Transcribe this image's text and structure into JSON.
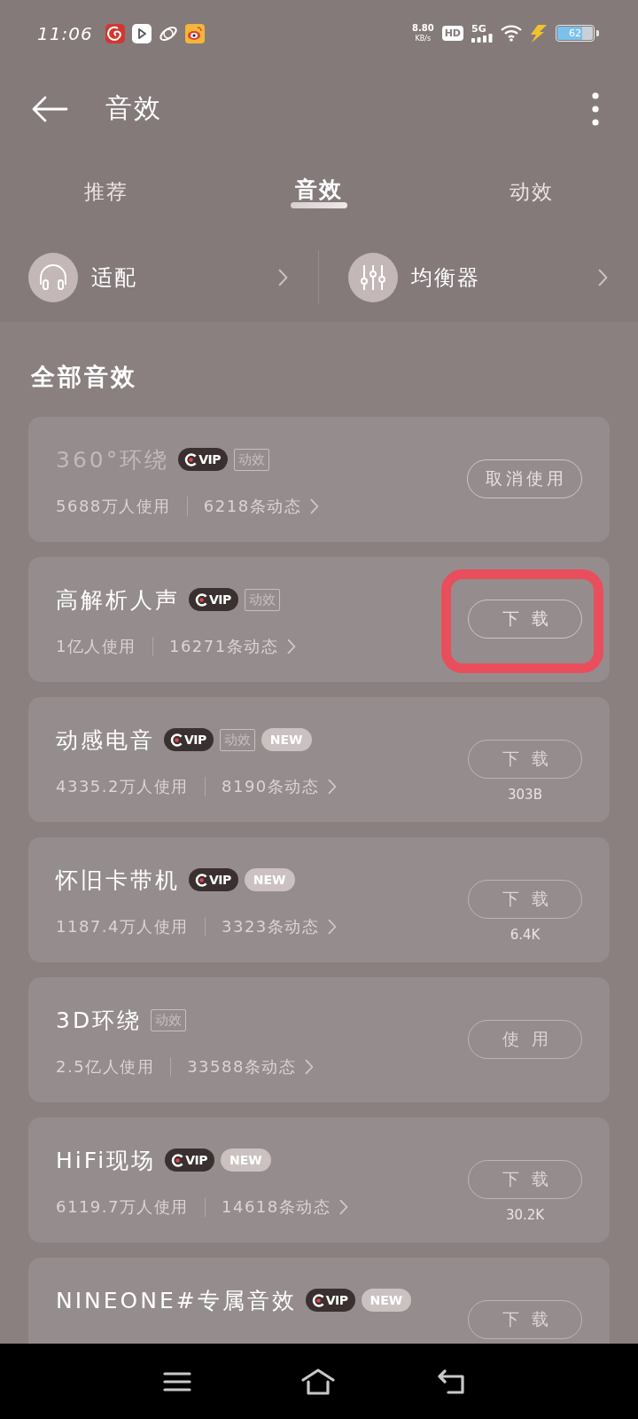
{
  "status_bar": {
    "time": "11:06",
    "speed_value": "8.80",
    "speed_unit": "KB/s",
    "hd_label": "HD",
    "network": "5G",
    "battery": "62"
  },
  "header": {
    "title": "音效"
  },
  "tabs": [
    {
      "label": "推荐",
      "selected": false
    },
    {
      "label": "音效",
      "selected": true
    },
    {
      "label": "动效",
      "selected": false
    }
  ],
  "shortcuts": [
    {
      "kind": "headphones",
      "label": "适配"
    },
    {
      "kind": "equalizer",
      "label": "均衡器"
    }
  ],
  "section_title": "全部音效",
  "effects": [
    {
      "name": "360°环绕",
      "in_use": true,
      "highlighted": false,
      "badges": [
        {
          "kind": "vip",
          "text": "VIP"
        },
        {
          "kind": "tag",
          "text": "动效"
        }
      ],
      "users": "5688万人使用",
      "posts": "6218条动态",
      "action": "取消使用"
    },
    {
      "name": "高解析人声",
      "in_use": false,
      "highlighted": true,
      "badges": [
        {
          "kind": "vip",
          "text": "VIP"
        },
        {
          "kind": "tag",
          "text": "动效"
        }
      ],
      "users": "1亿人使用",
      "posts": "16271条动态",
      "action": "下载"
    },
    {
      "name": "动感电音",
      "in_use": false,
      "highlighted": false,
      "badges": [
        {
          "kind": "vip",
          "text": "VIP"
        },
        {
          "kind": "tag",
          "text": "动效"
        },
        {
          "kind": "new",
          "text": "NEW"
        }
      ],
      "users": "4335.2万人使用",
      "posts": "8190条动态",
      "action": "下载",
      "size": "303B"
    },
    {
      "name": "怀旧卡带机",
      "in_use": false,
      "highlighted": false,
      "badges": [
        {
          "kind": "vip",
          "text": "VIP"
        },
        {
          "kind": "new",
          "text": "NEW"
        }
      ],
      "users": "1187.4万人使用",
      "posts": "3323条动态",
      "action": "下载",
      "size": "6.4K"
    },
    {
      "name": "3D环绕",
      "in_use": false,
      "highlighted": false,
      "badges": [
        {
          "kind": "tag",
          "text": "动效"
        }
      ],
      "users": "2.5亿人使用",
      "posts": "33588条动态",
      "action": "使用"
    },
    {
      "name": "HiFi现场",
      "in_use": false,
      "highlighted": false,
      "badges": [
        {
          "kind": "vip",
          "text": "VIP"
        },
        {
          "kind": "new",
          "text": "NEW"
        }
      ],
      "users": "6119.7万人使用",
      "posts": "14618条动态",
      "action": "下载",
      "size": "30.2K"
    },
    {
      "name": "NINEONE#专属音效",
      "in_use": false,
      "highlighted": false,
      "badges": [
        {
          "kind": "vip",
          "text": "VIP"
        },
        {
          "kind": "new",
          "text": "NEW"
        }
      ],
      "action": "下载"
    }
  ]
}
